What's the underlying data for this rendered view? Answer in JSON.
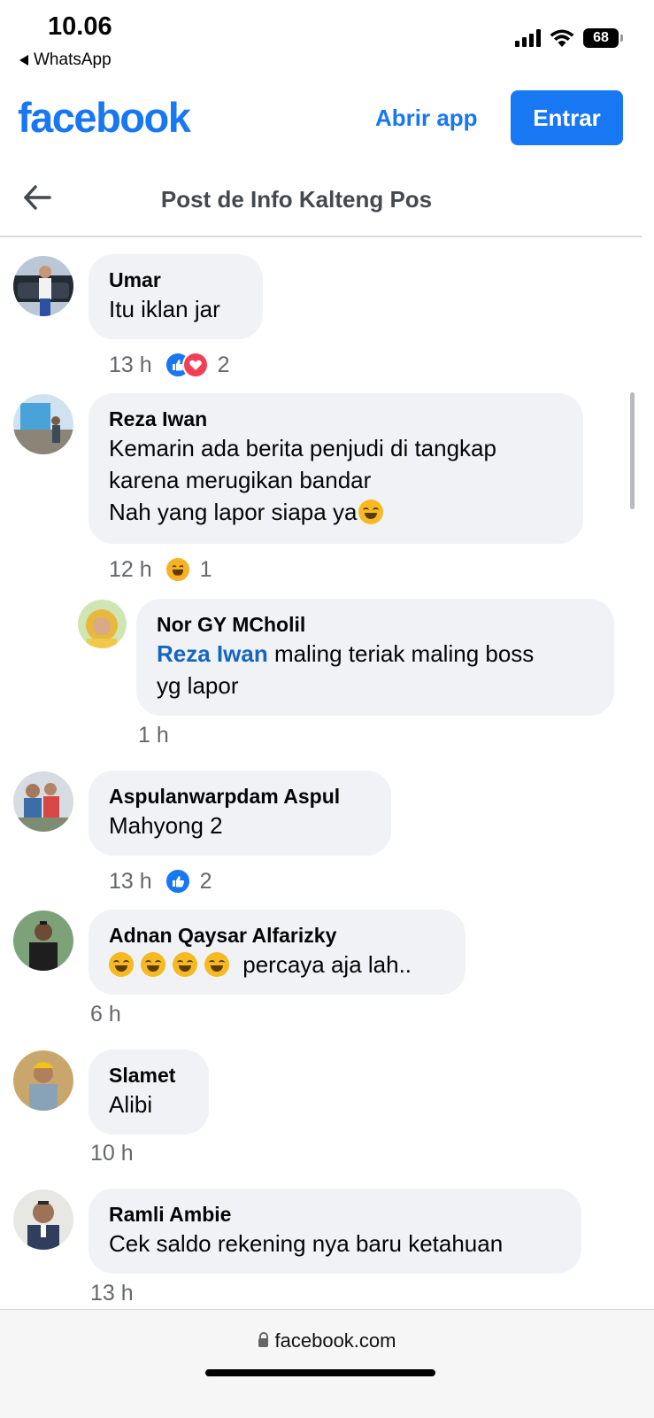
{
  "status_bar": {
    "time": "10.06",
    "back_app": "WhatsApp",
    "battery": "68"
  },
  "header": {
    "logo": "facebook",
    "open_app": "Abrir app",
    "login": "Entrar"
  },
  "nav": {
    "title": "Post de Info Kalteng Pos"
  },
  "comments": [
    {
      "name": "Umar",
      "text": "Itu iklan jar",
      "time": "13 h",
      "reactions": [
        "like",
        "love"
      ],
      "reaction_count": "2"
    },
    {
      "name": "Reza Iwan",
      "lines": [
        "Kemarin ada berita penjudi di tangkap",
        "karena merugikan bandar",
        "Nah yang lapor siapa ya"
      ],
      "time": "12 h",
      "reactions": [
        "haha"
      ],
      "reaction_count": "1"
    },
    {
      "name": "Nor GY MCholil",
      "mention": "Reza Iwan",
      "text_line1": " maling teriak maling boss",
      "text_line2": "yg lapor",
      "time": "1 h"
    },
    {
      "name": "Aspulanwarpdam Aspul",
      "text": "Mahyong 2",
      "time": "13 h",
      "reactions": [
        "like"
      ],
      "reaction_count": "2"
    },
    {
      "name": "Adnan Qaysar Alfarizky",
      "text": "percaya aja lah..",
      "time": "6 h"
    },
    {
      "name": "Slamet",
      "text": "Alibi",
      "time": "10 h"
    },
    {
      "name": "Ramli Ambie",
      "text": "Cek saldo rekening nya baru ketahuan",
      "time": "13 h"
    }
  ],
  "bottom_bar": {
    "url": "facebook.com"
  }
}
